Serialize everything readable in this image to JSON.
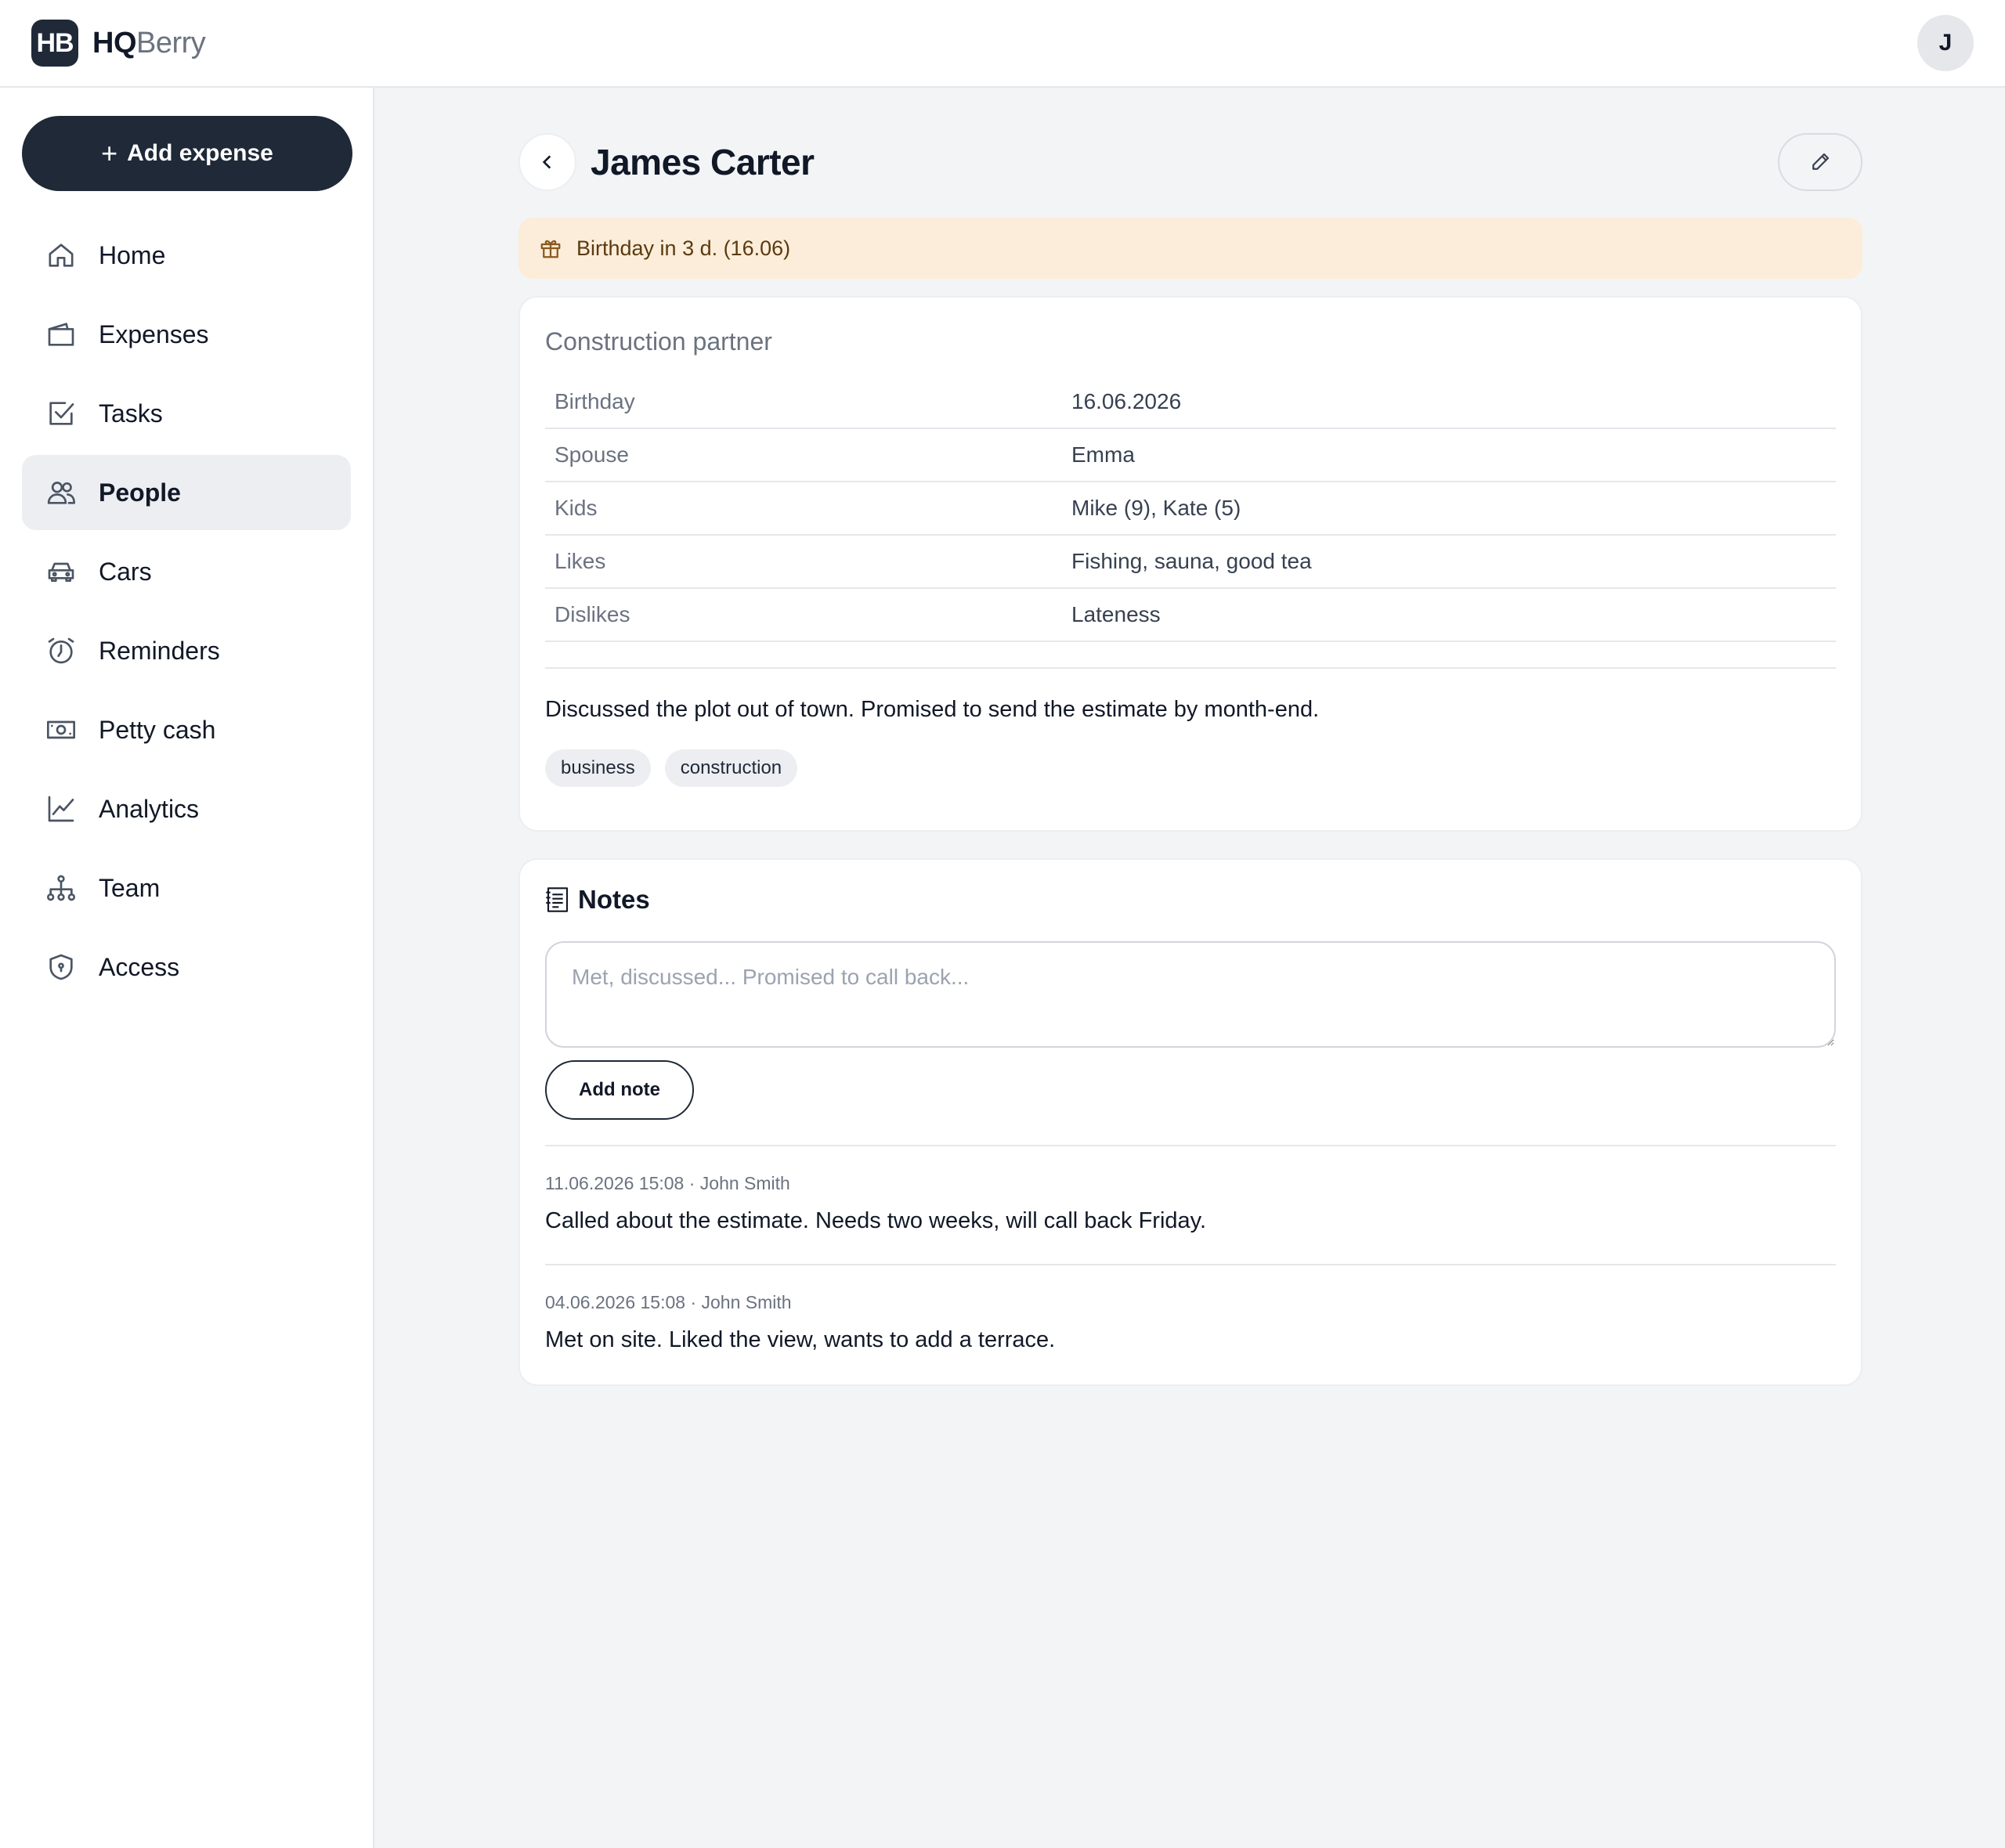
{
  "brand": {
    "logo": "HB",
    "name_bold": "HQ",
    "name_light": "Berry"
  },
  "user": {
    "initial": "J"
  },
  "sidebar": {
    "add_expense_label": "Add expense",
    "items": [
      {
        "label": "Home",
        "icon": "home-icon"
      },
      {
        "label": "Expenses",
        "icon": "wallet-icon"
      },
      {
        "label": "Tasks",
        "icon": "checkbox-icon"
      },
      {
        "label": "People",
        "icon": "people-icon",
        "active": true
      },
      {
        "label": "Cars",
        "icon": "car-icon"
      },
      {
        "label": "Reminders",
        "icon": "alarm-clock-icon"
      },
      {
        "label": "Petty cash",
        "icon": "cash-icon"
      },
      {
        "label": "Analytics",
        "icon": "chart-line-icon"
      },
      {
        "label": "Team",
        "icon": "org-chart-icon"
      },
      {
        "label": "Access",
        "icon": "shield-icon"
      }
    ]
  },
  "person": {
    "name": "James Carter",
    "birthday_banner": "Birthday in 3 d. (16.06)",
    "role": "Construction partner",
    "details": [
      {
        "label": "Birthday",
        "value": "16.06.2026"
      },
      {
        "label": "Spouse",
        "value": "Emma"
      },
      {
        "label": "Kids",
        "value": "Mike (9), Kate (5)"
      },
      {
        "label": "Likes",
        "value": "Fishing, sauna, good tea"
      },
      {
        "label": "Dislikes",
        "value": "Lateness"
      }
    ],
    "description": "Discussed the plot out of town. Promised to send the estimate by month-end.",
    "tags": [
      "business",
      "construction"
    ]
  },
  "notes": {
    "title": "Notes",
    "placeholder": "Met, discussed... Promised to call back...",
    "add_label": "Add note",
    "entries": [
      {
        "meta": "11.06.2026 15:08 · John Smith",
        "text": "Called about the estimate. Needs two weeks, will call back Friday."
      },
      {
        "meta": "04.06.2026 15:08 · John Smith",
        "text": "Met on site. Liked the view, wants to add a terrace."
      }
    ]
  },
  "colors": {
    "accent": "#1f2937",
    "banner_bg": "#fbedd9",
    "page_bg": "#f3f4f6"
  }
}
